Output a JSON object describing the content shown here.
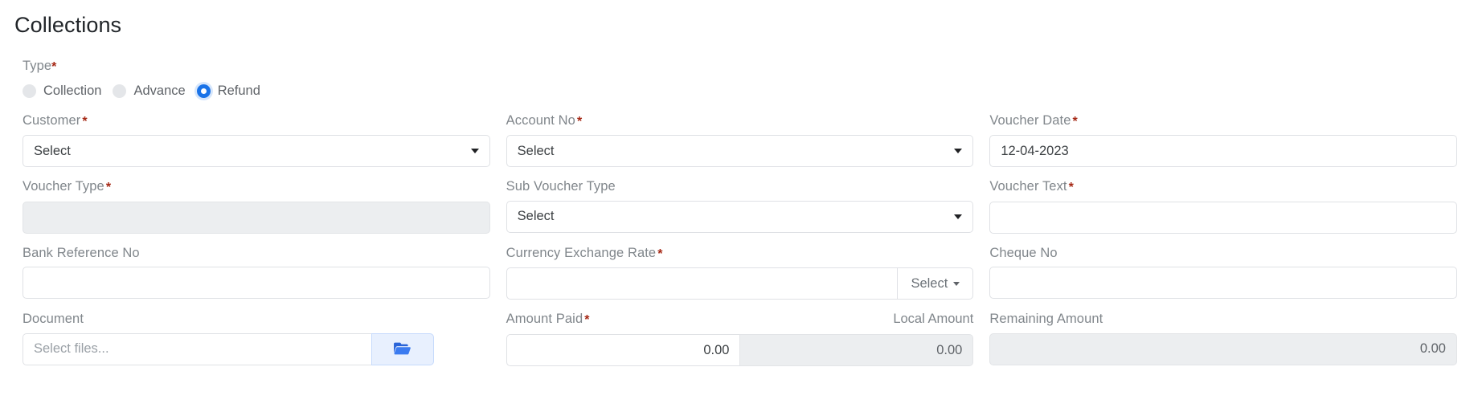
{
  "page": {
    "title": "Collections"
  },
  "type_field": {
    "label": "Type",
    "required": true,
    "options": [
      {
        "label": "Collection",
        "selected": false
      },
      {
        "label": "Advance",
        "selected": false
      },
      {
        "label": "Refund",
        "selected": true
      }
    ]
  },
  "fields": {
    "customer": {
      "label": "Customer",
      "required": true,
      "control": "select",
      "value": "Select"
    },
    "account_no": {
      "label": "Account No",
      "required": true,
      "control": "select",
      "value": "Select"
    },
    "voucher_date": {
      "label": "Voucher Date",
      "required": true,
      "control": "text",
      "value": "12-04-2023"
    },
    "voucher_type": {
      "label": "Voucher Type",
      "required": true,
      "control": "text-disabled",
      "value": ""
    },
    "sub_voucher_type": {
      "label": "Sub Voucher Type",
      "required": false,
      "control": "select",
      "value": "Select"
    },
    "voucher_text": {
      "label": "Voucher Text",
      "required": true,
      "control": "text",
      "value": ""
    },
    "bank_reference_no": {
      "label": "Bank Reference No",
      "required": false,
      "control": "text",
      "value": ""
    },
    "currency_exchange_rate": {
      "label": "Currency Exchange Rate",
      "required": true,
      "control": "text-with-addon",
      "value": "",
      "addon_label": "Select"
    },
    "cheque_no": {
      "label": "Cheque No",
      "required": false,
      "control": "text",
      "value": ""
    },
    "document": {
      "label": "Document",
      "required": false,
      "control": "file",
      "placeholder": "Select files...",
      "button_icon": "folder-open-icon"
    },
    "amount_paid": {
      "label": "Amount Paid",
      "required": true,
      "control": "number",
      "value": "0.00"
    },
    "local_amount": {
      "label": "Local Amount",
      "required": false,
      "control": "number-disabled",
      "value": "0.00"
    },
    "remaining_amount": {
      "label": "Remaining Amount",
      "required": false,
      "control": "number-disabled",
      "value": "0.00"
    }
  },
  "colors": {
    "accent": "#1a73e8",
    "required_asterisk": "#a52714",
    "label_text": "#80868b",
    "border": "#dfe1e5",
    "disabled_bg": "#eceef0",
    "file_button_bg": "#e8f0fe"
  }
}
